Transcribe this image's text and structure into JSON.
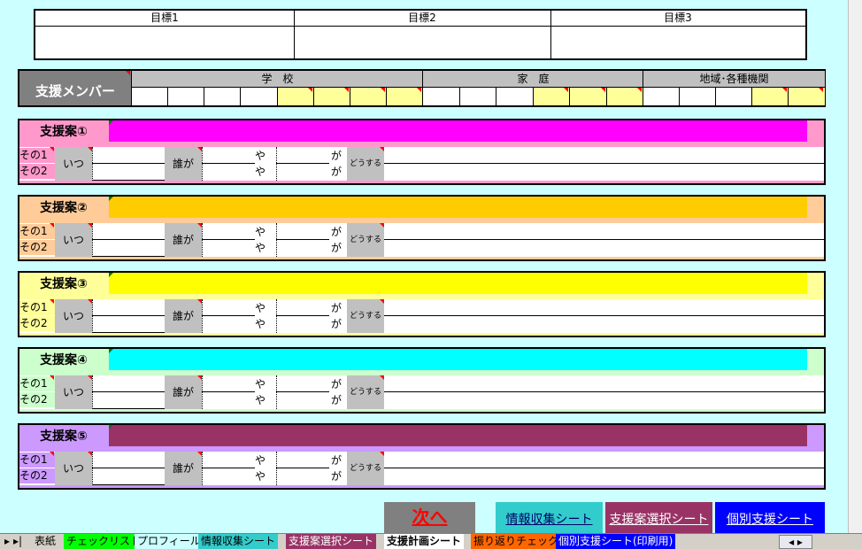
{
  "goals": [
    "目標1",
    "目標2",
    "目標3"
  ],
  "members": {
    "label": "支援メンバー",
    "groups": [
      "学　校",
      "家　庭",
      "地域･各種機関"
    ]
  },
  "plans": [
    {
      "title": "支援案①",
      "bg": "#ff99cc",
      "bar": "#ff00ff"
    },
    {
      "title": "支援案②",
      "bg": "#ffcc99",
      "bar": "#ffcc00"
    },
    {
      "title": "支援案③",
      "bg": "#ffff99",
      "bar": "#ffff00"
    },
    {
      "title": "支援案④",
      "bg": "#ccffcc",
      "bar": "#00ffff"
    },
    {
      "title": "支援案⑤",
      "bg": "#cc99ff",
      "bar": "#993366"
    }
  ],
  "plan_labels": {
    "sono1": "その1",
    "sono2": "その2",
    "itsu": "いつ",
    "darega": "誰が",
    "ya": "や",
    "ga": "が",
    "dousuru": "どうする"
  },
  "buttons": {
    "next": "次へ",
    "info": "情報収集シート",
    "select": "支援案選択シート",
    "individual": "個別支援シート"
  },
  "sheet_tabs": [
    "表紙",
    "チェックリスト",
    "プロフィール",
    "情報収集シート",
    "支援案選択シート",
    "支援計画シート",
    "振り返りチェック",
    "個別支援シート(印刷用)"
  ]
}
